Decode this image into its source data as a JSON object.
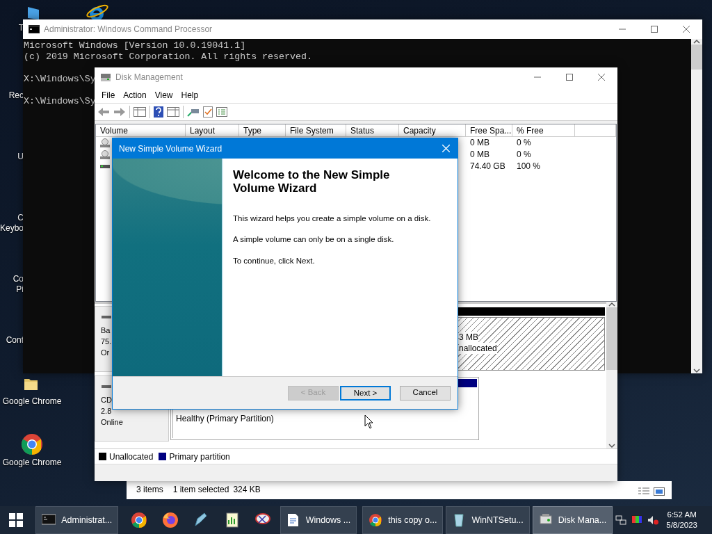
{
  "desktop_icons": [
    {
      "lines": [
        "T"
      ]
    },
    {
      "lines": [
        "Rec"
      ]
    },
    {
      "lines": [
        "U"
      ]
    },
    {
      "lines": [
        "C",
        "Keybo"
      ]
    },
    {
      "lines": [
        "Co",
        "Pi"
      ]
    },
    {
      "lines": [
        "Cont"
      ]
    },
    {
      "lines": [
        "Google Chrome"
      ]
    },
    {
      "lines": [
        "Google Chrome"
      ]
    }
  ],
  "cmd_window": {
    "title": "Administrator: Windows Command Processor",
    "blocks": [
      [
        "Microsoft Windows [Version 10.0.19041.1]",
        "(c) 2019 Microsoft Corporation. All rights reserved."
      ],
      [
        "X:\\Windows\\Sy"
      ],
      [
        "X:\\Windows\\Sy"
      ]
    ]
  },
  "explorer_status": [
    "3 items",
    "1 item selected",
    "324 KB"
  ],
  "disk_management": {
    "title": "Disk Management",
    "menu": [
      "File",
      "Action",
      "View",
      "Help"
    ],
    "columns": [
      "Volume",
      "Layout",
      "Type",
      "File System",
      "Status",
      "Capacity",
      "Free Spa...",
      "% Free"
    ],
    "rows": [
      {
        "free_space": "0 MB",
        "percent_free": "0 %"
      },
      {
        "free_space": "0 MB",
        "percent_free": "0 %"
      },
      {
        "free_space": "74.40 GB",
        "percent_free": "100 %"
      }
    ],
    "disks": [
      {
        "info": [
          "Ba",
          "75.",
          "Or"
        ],
        "partition": {
          "kind": "unallocated",
          "lines": [
            "3 MB",
            "nallocated"
          ]
        }
      },
      {
        "info": [
          "CD",
          "2.8",
          "Online"
        ],
        "partition": {
          "kind": "primary",
          "lines": [
            "Healthy (Primary Partition)"
          ]
        }
      }
    ],
    "legend": [
      {
        "label": "Unallocated",
        "color": "#000000"
      },
      {
        "label": "Primary partition",
        "color": "#000080"
      }
    ]
  },
  "wizard": {
    "title": "New Simple Volume Wizard",
    "heading": "Welcome to the New Simple Volume Wizard",
    "paragraphs": [
      "This wizard helps you create a simple volume on a disk.",
      "A simple volume can only be on a single disk.",
      "To continue, click Next."
    ],
    "buttons": [
      {
        "label": "< Back",
        "disabled": true,
        "default": false
      },
      {
        "label": "Next >",
        "disabled": false,
        "default": true
      },
      {
        "label": "Cancel",
        "disabled": false,
        "default": false
      }
    ]
  },
  "taskbar": {
    "items": [
      {
        "kind": "window",
        "label": "Administrat...",
        "active": false
      },
      {
        "kind": "pin"
      },
      {
        "kind": "pin"
      },
      {
        "kind": "pin"
      },
      {
        "kind": "pin"
      },
      {
        "kind": "pin"
      },
      {
        "kind": "window",
        "label": "Windows ...",
        "active": false
      },
      {
        "kind": "window",
        "label": "this copy o...",
        "active": false
      },
      {
        "kind": "window",
        "label": "WinNTSetu...",
        "active": false
      },
      {
        "kind": "window",
        "label": "Disk Mana...",
        "active": true
      }
    ],
    "clock": {
      "time": "6:52 AM",
      "date": "5/8/2023"
    }
  }
}
